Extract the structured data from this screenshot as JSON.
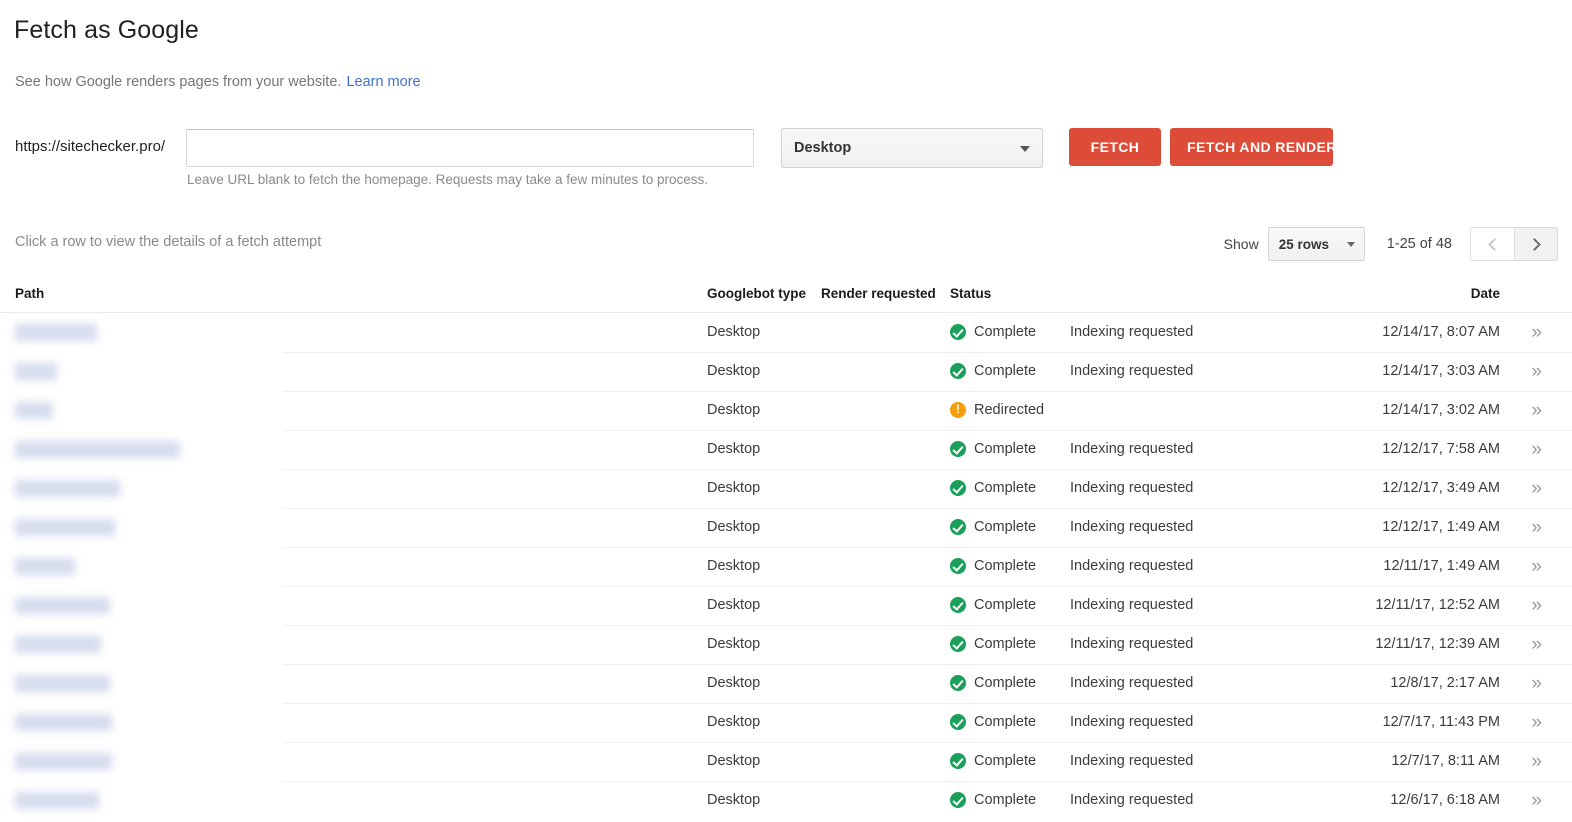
{
  "header": {
    "title": "Fetch as Google",
    "subtitle": "See how Google renders pages from your website.",
    "learn_more": "Learn more"
  },
  "fetch_bar": {
    "url_prefix": "https://sitechecker.pro/",
    "url_value": "",
    "url_placeholder": "",
    "url_hint": "Leave URL blank to fetch the homepage. Requests may take a few minutes to process.",
    "bot_type_selected": "Desktop",
    "fetch_label": "FETCH",
    "fetch_and_render_label": "FETCH AND RENDER",
    "button_color": "#dd4b39"
  },
  "table_toolbar": {
    "hint": "Click a row to view the details of a fetch attempt",
    "show_label": "Show",
    "rows_selected": "25 rows",
    "range": "1-25 of 48",
    "prev_icon": "chevron-left-icon",
    "next_icon": "chevron-right-icon"
  },
  "table": {
    "columns": [
      "Path",
      "Googlebot type",
      "Render requested",
      "Status",
      "Date"
    ],
    "rows": [
      {
        "path_redacted_width": 82,
        "googlebot_type": "Desktop",
        "render_requested": "",
        "status": "Complete",
        "status_icon": "check-circle-icon",
        "indexing": "Indexing requested",
        "date": "12/14/17, 8:07 AM",
        "expand_icon": "double-chevron-right-icon"
      },
      {
        "path_redacted_width": 42,
        "googlebot_type": "Desktop",
        "render_requested": "",
        "status": "Complete",
        "status_icon": "check-circle-icon",
        "indexing": "Indexing requested",
        "date": "12/14/17, 3:03 AM",
        "expand_icon": "double-chevron-right-icon"
      },
      {
        "path_redacted_width": 38,
        "googlebot_type": "Desktop",
        "render_requested": "",
        "status": "Redirected",
        "status_icon": "warning-circle-icon",
        "indexing": "",
        "date": "12/14/17, 3:02 AM",
        "expand_icon": "double-chevron-right-icon"
      },
      {
        "path_redacted_width": 165,
        "googlebot_type": "Desktop",
        "render_requested": "",
        "status": "Complete",
        "status_icon": "check-circle-icon",
        "indexing": "Indexing requested",
        "date": "12/12/17, 7:58 AM",
        "expand_icon": "double-chevron-right-icon"
      },
      {
        "path_redacted_width": 105,
        "googlebot_type": "Desktop",
        "render_requested": "",
        "status": "Complete",
        "status_icon": "check-circle-icon",
        "indexing": "Indexing requested",
        "date": "12/12/17, 3:49 AM",
        "expand_icon": "double-chevron-right-icon"
      },
      {
        "path_redacted_width": 100,
        "googlebot_type": "Desktop",
        "render_requested": "",
        "status": "Complete",
        "status_icon": "check-circle-icon",
        "indexing": "Indexing requested",
        "date": "12/12/17, 1:49 AM",
        "expand_icon": "double-chevron-right-icon"
      },
      {
        "path_redacted_width": 60,
        "googlebot_type": "Desktop",
        "render_requested": "",
        "status": "Complete",
        "status_icon": "check-circle-icon",
        "indexing": "Indexing requested",
        "date": "12/11/17, 1:49 AM",
        "expand_icon": "double-chevron-right-icon"
      },
      {
        "path_redacted_width": 95,
        "googlebot_type": "Desktop",
        "render_requested": "",
        "status": "Complete",
        "status_icon": "check-circle-icon",
        "indexing": "Indexing requested",
        "date": "12/11/17, 12:52 AM",
        "expand_icon": "double-chevron-right-icon"
      },
      {
        "path_redacted_width": 86,
        "googlebot_type": "Desktop",
        "render_requested": "",
        "status": "Complete",
        "status_icon": "check-circle-icon",
        "indexing": "Indexing requested",
        "date": "12/11/17, 12:39 AM",
        "expand_icon": "double-chevron-right-icon"
      },
      {
        "path_redacted_width": 95,
        "googlebot_type": "Desktop",
        "render_requested": "",
        "status": "Complete",
        "status_icon": "check-circle-icon",
        "indexing": "Indexing requested",
        "date": "12/8/17, 2:17 AM",
        "expand_icon": "double-chevron-right-icon"
      },
      {
        "path_redacted_width": 97,
        "googlebot_type": "Desktop",
        "render_requested": "",
        "status": "Complete",
        "status_icon": "check-circle-icon",
        "indexing": "Indexing requested",
        "date": "12/7/17, 11:43 PM",
        "expand_icon": "double-chevron-right-icon"
      },
      {
        "path_redacted_width": 97,
        "googlebot_type": "Desktop",
        "render_requested": "",
        "status": "Complete",
        "status_icon": "check-circle-icon",
        "indexing": "Indexing requested",
        "date": "12/7/17, 8:11 AM",
        "expand_icon": "double-chevron-right-icon"
      },
      {
        "path_redacted_width": 84,
        "googlebot_type": "Desktop",
        "render_requested": "",
        "status": "Complete",
        "status_icon": "check-circle-icon",
        "indexing": "Indexing requested",
        "date": "12/6/17, 6:18 AM",
        "expand_icon": "double-chevron-right-icon"
      }
    ]
  }
}
